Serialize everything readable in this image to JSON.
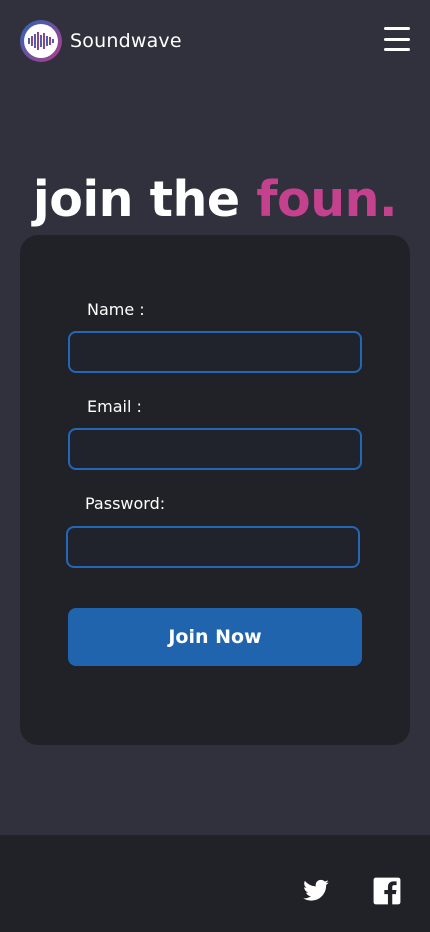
{
  "header": {
    "brand": "Soundwave",
    "logo_icon": "soundwave-bars-icon",
    "menu_icon": "hamburger-menu-icon"
  },
  "hero": {
    "title_prefix": "join the ",
    "title_accent": "foun."
  },
  "form": {
    "name_label": "Name :",
    "name_value": "",
    "email_label": "Email :",
    "email_value": "",
    "password_label": "Password:",
    "password_value": "",
    "submit_label": "Join Now"
  },
  "footer": {
    "social": [
      "twitter-icon",
      "facebook-icon"
    ]
  },
  "colors": {
    "background": "#30313d",
    "card": "#212228",
    "accent": "#c4418d",
    "primary": "#1f64ad",
    "input_border": "#2467b4"
  }
}
